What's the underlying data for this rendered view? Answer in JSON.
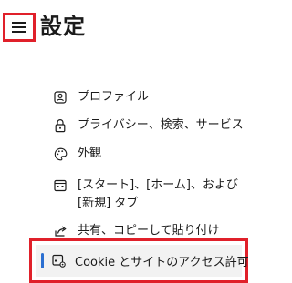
{
  "header": {
    "title": "設定",
    "menu_icon": "hamburger-menu-icon"
  },
  "nav": {
    "items": [
      {
        "label": "プロファイル",
        "icon": "profile-icon"
      },
      {
        "label": "プライバシー、検索、サービス",
        "icon": "lock-icon"
      },
      {
        "label": "外観",
        "icon": "palette-icon"
      },
      {
        "label": "[スタート]、[ホーム]、および [新規] タブ",
        "icon": "home-tab-icon"
      },
      {
        "label": "共有、コピーして貼り付け",
        "icon": "share-icon"
      },
      {
        "label": "Cookie とサイトのアクセス許可",
        "icon": "cookie-site-permissions-icon",
        "selected": true
      }
    ]
  },
  "colors": {
    "highlight_border": "#e0202a",
    "selection_accent": "#2b6fd1",
    "selected_background": "#f2f2f2"
  }
}
